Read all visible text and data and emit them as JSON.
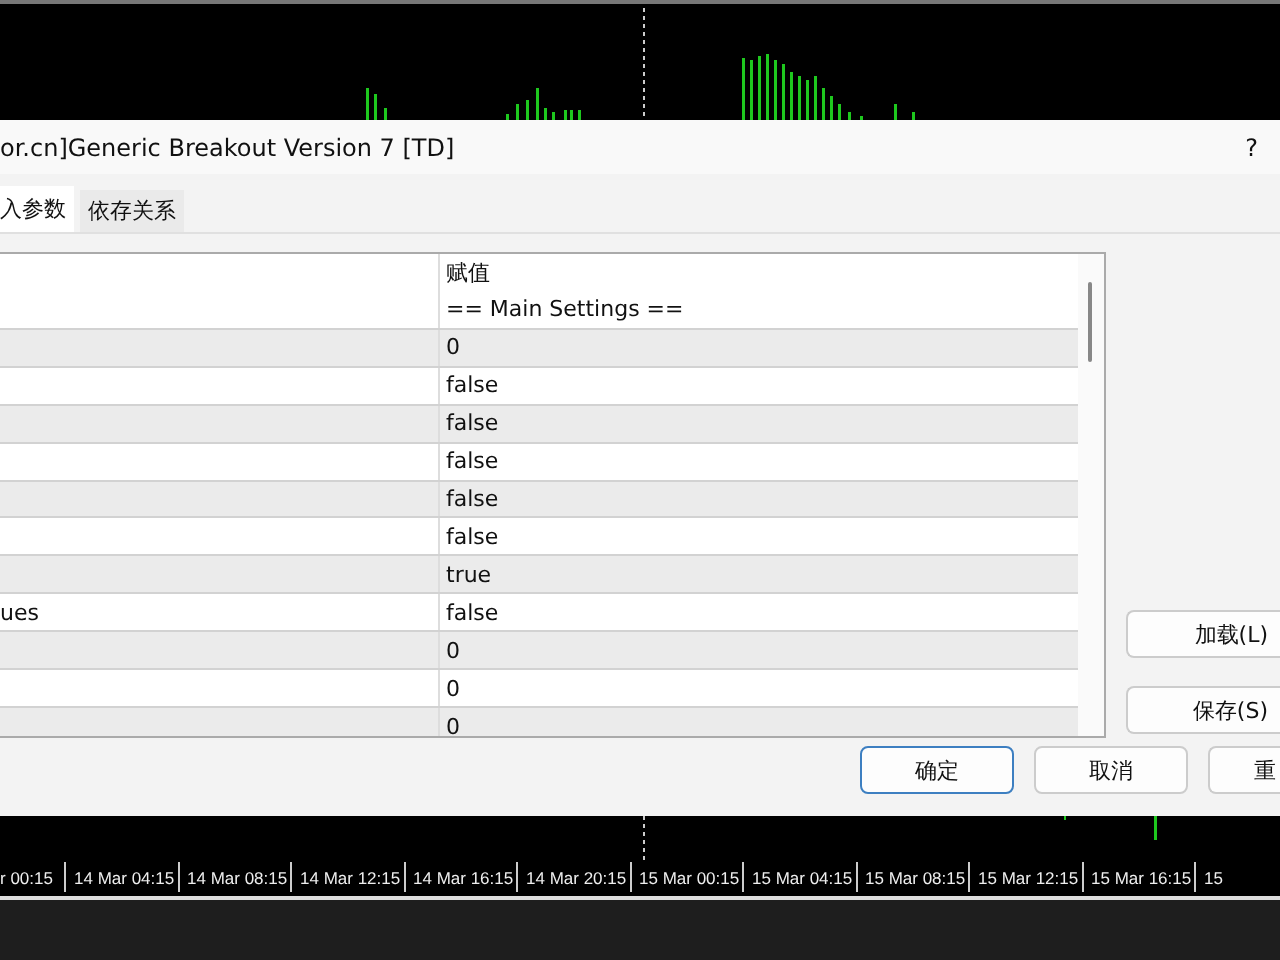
{
  "dialog": {
    "title": "or.cn]Generic Breakout Version 7 [TD]",
    "help": "?",
    "tabs": [
      {
        "label": "入参数",
        "selected": true
      },
      {
        "label": "依存关系",
        "selected": false
      }
    ],
    "table": {
      "value_header": "赋值",
      "rows": [
        {
          "value": "== Main Settings =="
        },
        {
          "value": "0"
        },
        {
          "value": "false"
        },
        {
          "value": "false"
        },
        {
          "value": "false"
        },
        {
          "value": "false"
        },
        {
          "value": "false"
        },
        {
          "value": "true"
        },
        {
          "column_1": "ues",
          "value": "false"
        },
        {
          "value": "0"
        },
        {
          "value": "0"
        },
        {
          "value": "0"
        }
      ]
    },
    "side_buttons": [
      "加载(L)",
      "保存(S)"
    ],
    "buttons": [
      {
        "label": "确定",
        "default": true
      },
      {
        "label": "取消",
        "default": false
      },
      {
        "label": "重",
        "default": false
      }
    ]
  },
  "time_axis": [
    "r 00:15",
    "14 Mar 04:15",
    "14 Mar 08:15",
    "14 Mar 12:15",
    "14 Mar 16:15",
    "14 Mar 20:15",
    "15 Mar 00:15",
    "15 Mar 04:15",
    "15 Mar 08:15",
    "15 Mar 12:15",
    "15 Mar 16:15",
    "15"
  ]
}
